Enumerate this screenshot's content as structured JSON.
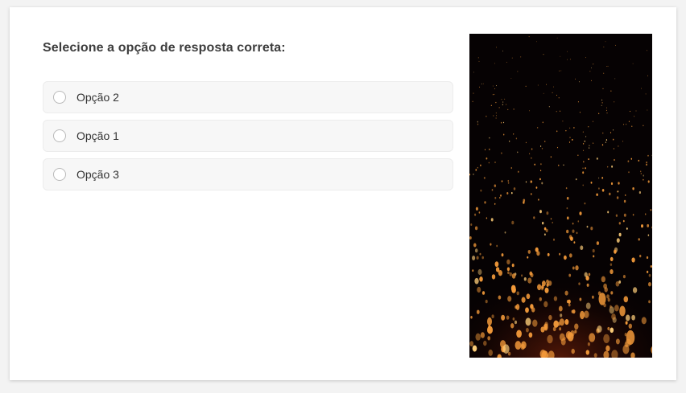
{
  "question": {
    "title": "Selecione a opção de resposta correta:"
  },
  "options": [
    {
      "label": "Opção 2",
      "selected": false
    },
    {
      "label": "Opção 1",
      "selected": false
    },
    {
      "label": "Opção 3",
      "selected": false
    }
  ],
  "media": {
    "subject": "night sky filled with floating sky lanterns",
    "colors": {
      "sky": "#060203",
      "lantern": "#f39a3a",
      "glow": "#ffcf7a"
    }
  }
}
